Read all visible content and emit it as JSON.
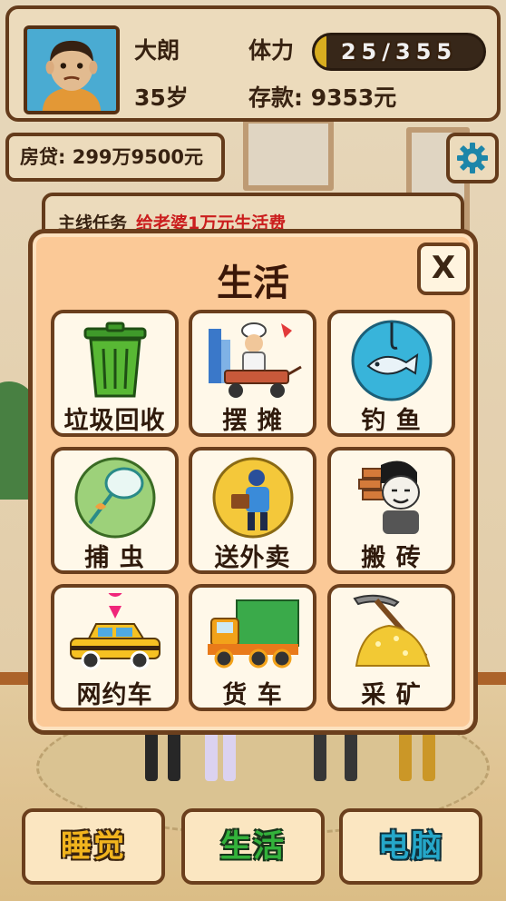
{
  "player": {
    "name": "大朗",
    "age": "35岁",
    "stamina_label": "体力",
    "stamina_value": "25/355",
    "stamina_fraction": 0.07,
    "savings": "存款: 9353元"
  },
  "mortgage": "房贷: 299万9500元",
  "task": {
    "label": "主线任务",
    "value": "给老婆1万元生活费"
  },
  "modal": {
    "title": "生活",
    "close_label": "X",
    "activities": [
      {
        "label": "垃圾回收",
        "icon": "trash-can-icon"
      },
      {
        "label": "摆 摊",
        "icon": "street-stall-icon"
      },
      {
        "label": "钓 鱼",
        "icon": "fishing-icon"
      },
      {
        "label": "捕 虫",
        "icon": "bug-net-icon"
      },
      {
        "label": "送外卖",
        "icon": "delivery-icon"
      },
      {
        "label": "搬 砖",
        "icon": "brick-carry-icon"
      },
      {
        "label": "网约车",
        "icon": "taxi-icon"
      },
      {
        "label": "货 车",
        "icon": "truck-icon"
      },
      {
        "label": "采 矿",
        "icon": "mining-icon"
      }
    ]
  },
  "bottom_nav": {
    "sleep": "睡觉",
    "life": "生活",
    "computer": "电脑"
  },
  "colors": {
    "panel_border": "#6b3f1d",
    "panel_bg": "#fbe9c8",
    "modal_bg": "#fbc997",
    "task_value": "#d82020",
    "stamina_fill": "#e6b822"
  }
}
